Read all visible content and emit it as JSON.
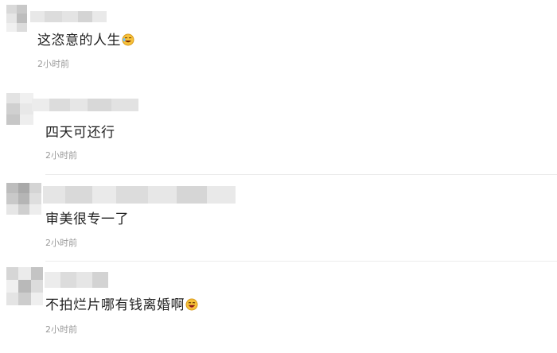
{
  "comments": [
    {
      "text": "这恣意的人生",
      "time": "2小时前",
      "emoji": "laughing-tears-icon"
    },
    {
      "text": "四天可还行",
      "time": "2小时前"
    },
    {
      "text": "审美很专一了",
      "time": "2小时前"
    },
    {
      "text": "不拍烂片哪有钱离婚啊",
      "time": "2小时前",
      "emoji": "grinning-face-icon"
    }
  ],
  "colors": {
    "time": "#9a9a9a",
    "text": "#1f1f1f",
    "divider": "#ececec",
    "emoji_face": "#f7c23a",
    "emoji_outline": "#d99a1c"
  }
}
